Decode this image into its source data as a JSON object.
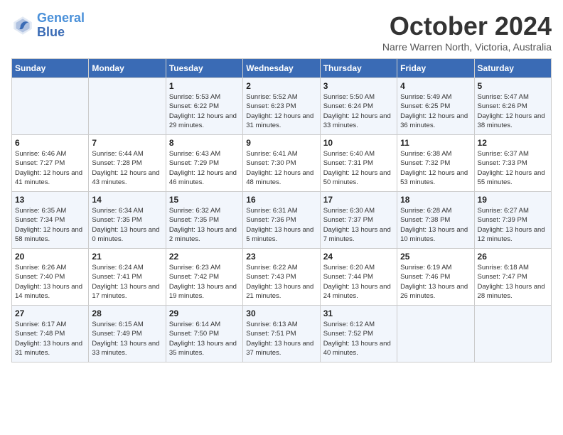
{
  "logo": {
    "line1": "General",
    "line2": "Blue"
  },
  "title": "October 2024",
  "location": "Narre Warren North, Victoria, Australia",
  "header_days": [
    "Sunday",
    "Monday",
    "Tuesday",
    "Wednesday",
    "Thursday",
    "Friday",
    "Saturday"
  ],
  "weeks": [
    [
      {
        "day": "",
        "sunrise": "",
        "sunset": "",
        "daylight": ""
      },
      {
        "day": "",
        "sunrise": "",
        "sunset": "",
        "daylight": ""
      },
      {
        "day": "1",
        "sunrise": "Sunrise: 5:53 AM",
        "sunset": "Sunset: 6:22 PM",
        "daylight": "Daylight: 12 hours and 29 minutes."
      },
      {
        "day": "2",
        "sunrise": "Sunrise: 5:52 AM",
        "sunset": "Sunset: 6:23 PM",
        "daylight": "Daylight: 12 hours and 31 minutes."
      },
      {
        "day": "3",
        "sunrise": "Sunrise: 5:50 AM",
        "sunset": "Sunset: 6:24 PM",
        "daylight": "Daylight: 12 hours and 33 minutes."
      },
      {
        "day": "4",
        "sunrise": "Sunrise: 5:49 AM",
        "sunset": "Sunset: 6:25 PM",
        "daylight": "Daylight: 12 hours and 36 minutes."
      },
      {
        "day": "5",
        "sunrise": "Sunrise: 5:47 AM",
        "sunset": "Sunset: 6:26 PM",
        "daylight": "Daylight: 12 hours and 38 minutes."
      }
    ],
    [
      {
        "day": "6",
        "sunrise": "Sunrise: 6:46 AM",
        "sunset": "Sunset: 7:27 PM",
        "daylight": "Daylight: 12 hours and 41 minutes."
      },
      {
        "day": "7",
        "sunrise": "Sunrise: 6:44 AM",
        "sunset": "Sunset: 7:28 PM",
        "daylight": "Daylight: 12 hours and 43 minutes."
      },
      {
        "day": "8",
        "sunrise": "Sunrise: 6:43 AM",
        "sunset": "Sunset: 7:29 PM",
        "daylight": "Daylight: 12 hours and 46 minutes."
      },
      {
        "day": "9",
        "sunrise": "Sunrise: 6:41 AM",
        "sunset": "Sunset: 7:30 PM",
        "daylight": "Daylight: 12 hours and 48 minutes."
      },
      {
        "day": "10",
        "sunrise": "Sunrise: 6:40 AM",
        "sunset": "Sunset: 7:31 PM",
        "daylight": "Daylight: 12 hours and 50 minutes."
      },
      {
        "day": "11",
        "sunrise": "Sunrise: 6:38 AM",
        "sunset": "Sunset: 7:32 PM",
        "daylight": "Daylight: 12 hours and 53 minutes."
      },
      {
        "day": "12",
        "sunrise": "Sunrise: 6:37 AM",
        "sunset": "Sunset: 7:33 PM",
        "daylight": "Daylight: 12 hours and 55 minutes."
      }
    ],
    [
      {
        "day": "13",
        "sunrise": "Sunrise: 6:35 AM",
        "sunset": "Sunset: 7:34 PM",
        "daylight": "Daylight: 12 hours and 58 minutes."
      },
      {
        "day": "14",
        "sunrise": "Sunrise: 6:34 AM",
        "sunset": "Sunset: 7:35 PM",
        "daylight": "Daylight: 13 hours and 0 minutes."
      },
      {
        "day": "15",
        "sunrise": "Sunrise: 6:32 AM",
        "sunset": "Sunset: 7:35 PM",
        "daylight": "Daylight: 13 hours and 2 minutes."
      },
      {
        "day": "16",
        "sunrise": "Sunrise: 6:31 AM",
        "sunset": "Sunset: 7:36 PM",
        "daylight": "Daylight: 13 hours and 5 minutes."
      },
      {
        "day": "17",
        "sunrise": "Sunrise: 6:30 AM",
        "sunset": "Sunset: 7:37 PM",
        "daylight": "Daylight: 13 hours and 7 minutes."
      },
      {
        "day": "18",
        "sunrise": "Sunrise: 6:28 AM",
        "sunset": "Sunset: 7:38 PM",
        "daylight": "Daylight: 13 hours and 10 minutes."
      },
      {
        "day": "19",
        "sunrise": "Sunrise: 6:27 AM",
        "sunset": "Sunset: 7:39 PM",
        "daylight": "Daylight: 13 hours and 12 minutes."
      }
    ],
    [
      {
        "day": "20",
        "sunrise": "Sunrise: 6:26 AM",
        "sunset": "Sunset: 7:40 PM",
        "daylight": "Daylight: 13 hours and 14 minutes."
      },
      {
        "day": "21",
        "sunrise": "Sunrise: 6:24 AM",
        "sunset": "Sunset: 7:41 PM",
        "daylight": "Daylight: 13 hours and 17 minutes."
      },
      {
        "day": "22",
        "sunrise": "Sunrise: 6:23 AM",
        "sunset": "Sunset: 7:42 PM",
        "daylight": "Daylight: 13 hours and 19 minutes."
      },
      {
        "day": "23",
        "sunrise": "Sunrise: 6:22 AM",
        "sunset": "Sunset: 7:43 PM",
        "daylight": "Daylight: 13 hours and 21 minutes."
      },
      {
        "day": "24",
        "sunrise": "Sunrise: 6:20 AM",
        "sunset": "Sunset: 7:44 PM",
        "daylight": "Daylight: 13 hours and 24 minutes."
      },
      {
        "day": "25",
        "sunrise": "Sunrise: 6:19 AM",
        "sunset": "Sunset: 7:46 PM",
        "daylight": "Daylight: 13 hours and 26 minutes."
      },
      {
        "day": "26",
        "sunrise": "Sunrise: 6:18 AM",
        "sunset": "Sunset: 7:47 PM",
        "daylight": "Daylight: 13 hours and 28 minutes."
      }
    ],
    [
      {
        "day": "27",
        "sunrise": "Sunrise: 6:17 AM",
        "sunset": "Sunset: 7:48 PM",
        "daylight": "Daylight: 13 hours and 31 minutes."
      },
      {
        "day": "28",
        "sunrise": "Sunrise: 6:15 AM",
        "sunset": "Sunset: 7:49 PM",
        "daylight": "Daylight: 13 hours and 33 minutes."
      },
      {
        "day": "29",
        "sunrise": "Sunrise: 6:14 AM",
        "sunset": "Sunset: 7:50 PM",
        "daylight": "Daylight: 13 hours and 35 minutes."
      },
      {
        "day": "30",
        "sunrise": "Sunrise: 6:13 AM",
        "sunset": "Sunset: 7:51 PM",
        "daylight": "Daylight: 13 hours and 37 minutes."
      },
      {
        "day": "31",
        "sunrise": "Sunrise: 6:12 AM",
        "sunset": "Sunset: 7:52 PM",
        "daylight": "Daylight: 13 hours and 40 minutes."
      },
      {
        "day": "",
        "sunrise": "",
        "sunset": "",
        "daylight": ""
      },
      {
        "day": "",
        "sunrise": "",
        "sunset": "",
        "daylight": ""
      }
    ]
  ]
}
